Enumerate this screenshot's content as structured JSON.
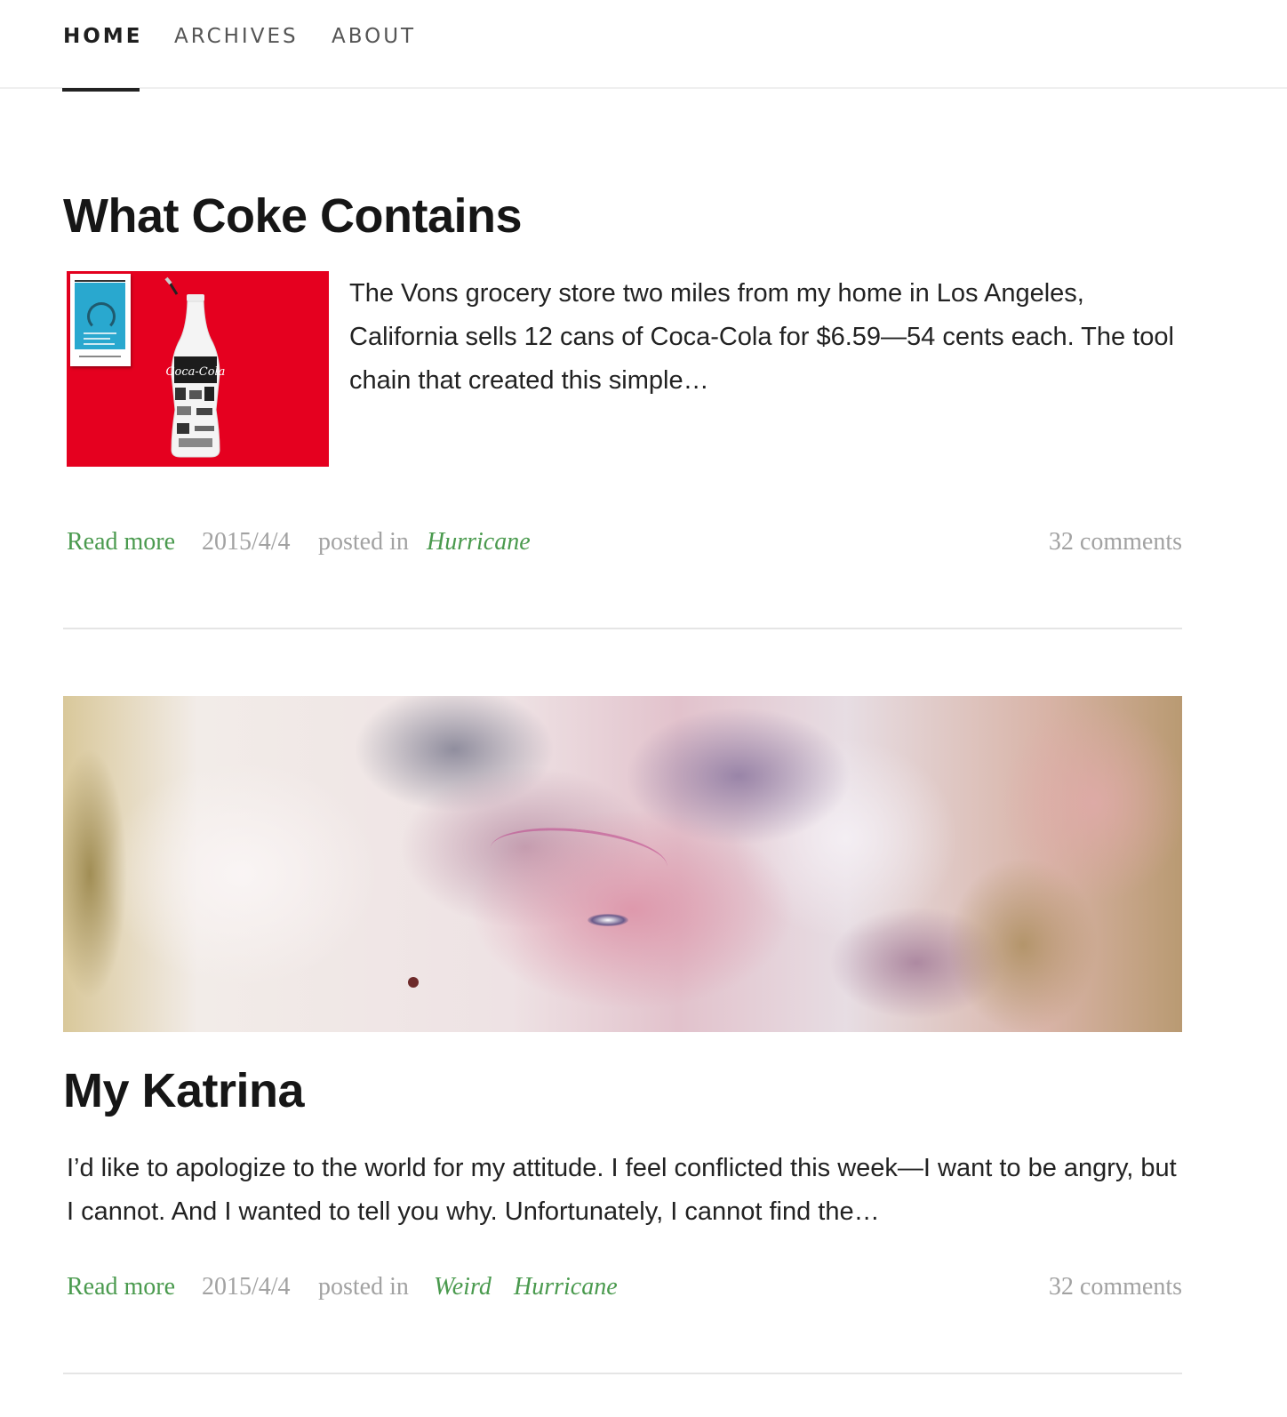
{
  "nav": {
    "items": [
      {
        "label": "HOME",
        "active": true
      },
      {
        "label": "ARCHIVES",
        "active": false
      },
      {
        "label": "ABOUT",
        "active": false
      }
    ]
  },
  "posts": [
    {
      "title": "What Coke Contains",
      "excerpt": "The Vons grocery store two miles from my home in Los Angeles, California sells 12 cans of Coca-Cola for $6.59—54 cents each. The tool chain that created this simple…",
      "read_more": "Read more",
      "date": "2015/4/4",
      "posted_in": "posted in",
      "categories": [
        "Hurricane"
      ],
      "comments": "32 comments"
    },
    {
      "title": "My Katrina",
      "excerpt": "I’d like to apologize to the world for my attitude. I feel conflicted this week—I want to be angry, but I cannot. And I wanted to tell you why. Unfortunately, I cannot find the…",
      "read_more": "Read more",
      "date": "2015/4/4",
      "posted_in": "posted in",
      "categories": [
        "Weird",
        "Hurricane"
      ],
      "comments": "32 comments"
    }
  ],
  "thumbnail": {
    "book_header": "AN EXTRACT FROM",
    "book_title": "HOW TO FLY A HORSE",
    "book_button": "ORDER NOW!",
    "bottle_logo": "Coca-Cola"
  },
  "colors": {
    "accent_green": "#4a9a4e",
    "meta_gray": "#a2a2a2",
    "thumbnail_red": "#e5001f"
  }
}
